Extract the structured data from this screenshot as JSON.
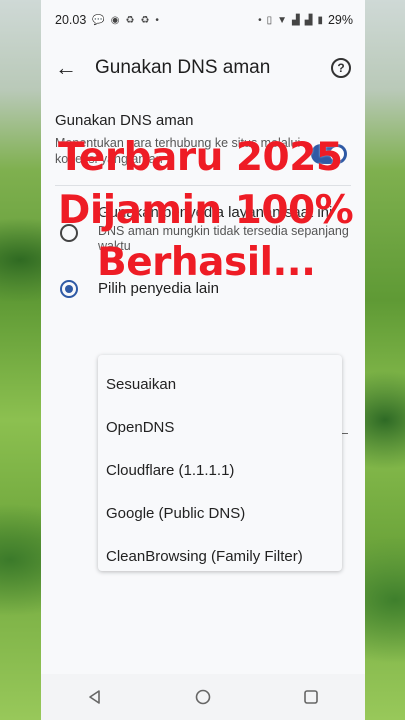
{
  "status_bar": {
    "time": "20.03",
    "battery": "29%"
  },
  "app_bar": {
    "title": "Gunakan DNS aman"
  },
  "secure_dns": {
    "title": "Gunakan DNS aman",
    "description": "Menentukan cara terhubung ke situs melalui koneksi yang aman",
    "enabled": true
  },
  "options": [
    {
      "label": "Gunakan penyedia layanan saat ini",
      "sublabel": "DNS aman mungkin tidak tersedia sepanjang waktu",
      "selected": false
    },
    {
      "label": "Pilih penyedia lain",
      "selected": true
    }
  ],
  "dropdown": {
    "items": [
      "Sesuaikan",
      "OpenDNS",
      "Cloudflare (1.1.1.1)",
      "Google (Public DNS)",
      "CleanBrowsing (Family Filter)"
    ]
  },
  "overlay_text": {
    "line1": "Terbaru 2025",
    "line2": "Dijamin 100%",
    "line3": "Berhasil..."
  },
  "colors": {
    "accent": "#2f5aa5",
    "overlay": "#ee1c25"
  }
}
